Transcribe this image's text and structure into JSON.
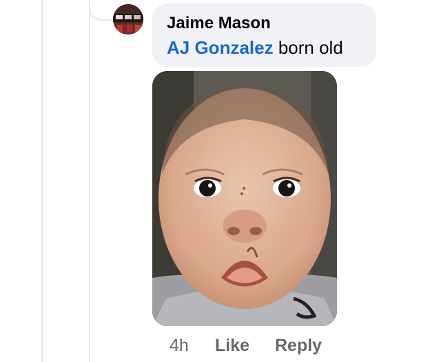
{
  "comment": {
    "author": "Jaime Mason",
    "mention": "AJ Gonzalez",
    "text": " born old",
    "avatar_icon": "profile-photo-avatar",
    "photo_icon": "attached-photo"
  },
  "actions": {
    "timestamp": "4h",
    "like_label": "Like",
    "reply_label": "Reply"
  },
  "colors": {
    "bubble": "#f0f2f5",
    "mention": "#1866d4",
    "meta_text": "#65676b",
    "thread_line": "#e4e6eb"
  }
}
